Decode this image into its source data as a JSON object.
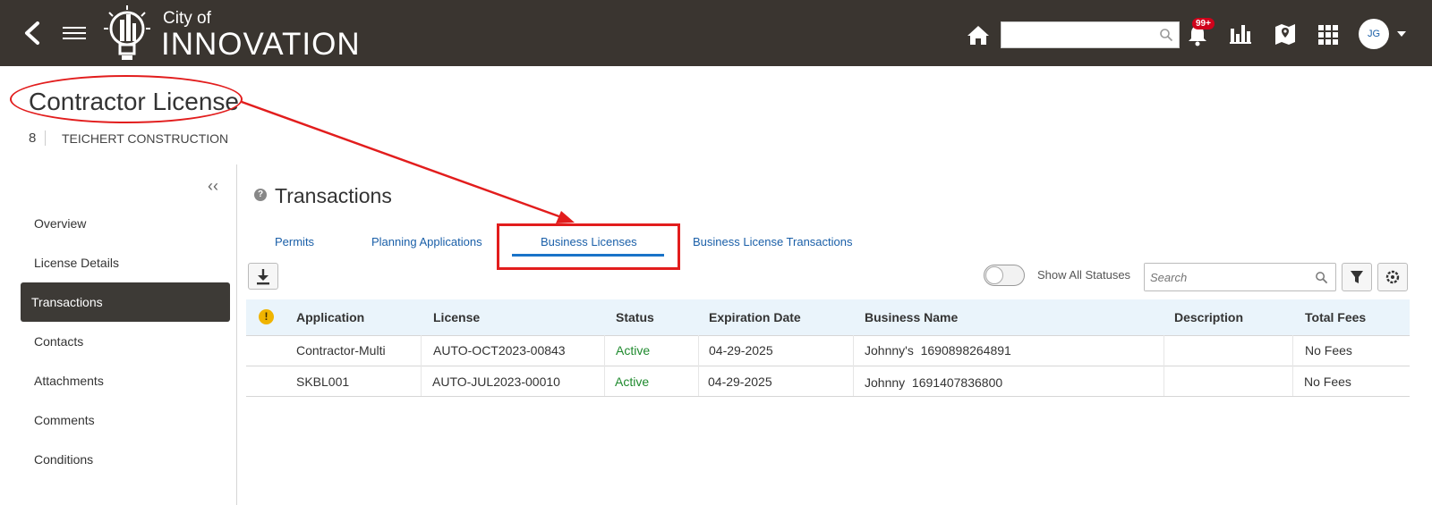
{
  "header": {
    "brand_top": "City of",
    "brand_main": "INNOVATION",
    "search_placeholder": "",
    "notification_count": "99+",
    "avatar_initials": "JG",
    "bg_color": "#3a3530"
  },
  "page": {
    "title": "Contractor License",
    "record_number": "8",
    "record_name": "TEICHERT CONSTRUCTION"
  },
  "sidebar": {
    "items": [
      {
        "label": "Overview",
        "active": false
      },
      {
        "label": "License Details",
        "active": false
      },
      {
        "label": "Transactions",
        "active": true
      },
      {
        "label": "Contacts",
        "active": false
      },
      {
        "label": "Attachments",
        "active": false
      },
      {
        "label": "Comments",
        "active": false
      },
      {
        "label": "Conditions",
        "active": false
      }
    ]
  },
  "main": {
    "section_title": "Transactions",
    "tabs": [
      {
        "label": "Permits",
        "selected": false
      },
      {
        "label": "Planning Applications",
        "selected": false
      },
      {
        "label": "Business Licenses",
        "selected": true
      },
      {
        "label": "Business License Transactions",
        "selected": false
      }
    ],
    "toggle_label": "Show All Statuses",
    "toggle_on": false,
    "search_placeholder": "Search"
  },
  "table": {
    "columns": [
      "Application",
      "License",
      "Status",
      "Expiration Date",
      "Business Name",
      "Description",
      "Total Fees"
    ],
    "rows": [
      [
        "Contractor-Multi",
        "AUTO-OCT2023-00843",
        "Active",
        "04-29-2025",
        "Johnny's  1690898264891",
        "",
        "No Fees"
      ],
      [
        "SKBL001",
        "AUTO-JUL2023-00010",
        "Active",
        "04-29-2025",
        "Johnny  1691407836800",
        "",
        "No Fees"
      ]
    ]
  },
  "colors": {
    "accent_blue": "#1a5fa8",
    "active_status": "#1f8a2e",
    "annotation_red": "#e21d1d"
  }
}
